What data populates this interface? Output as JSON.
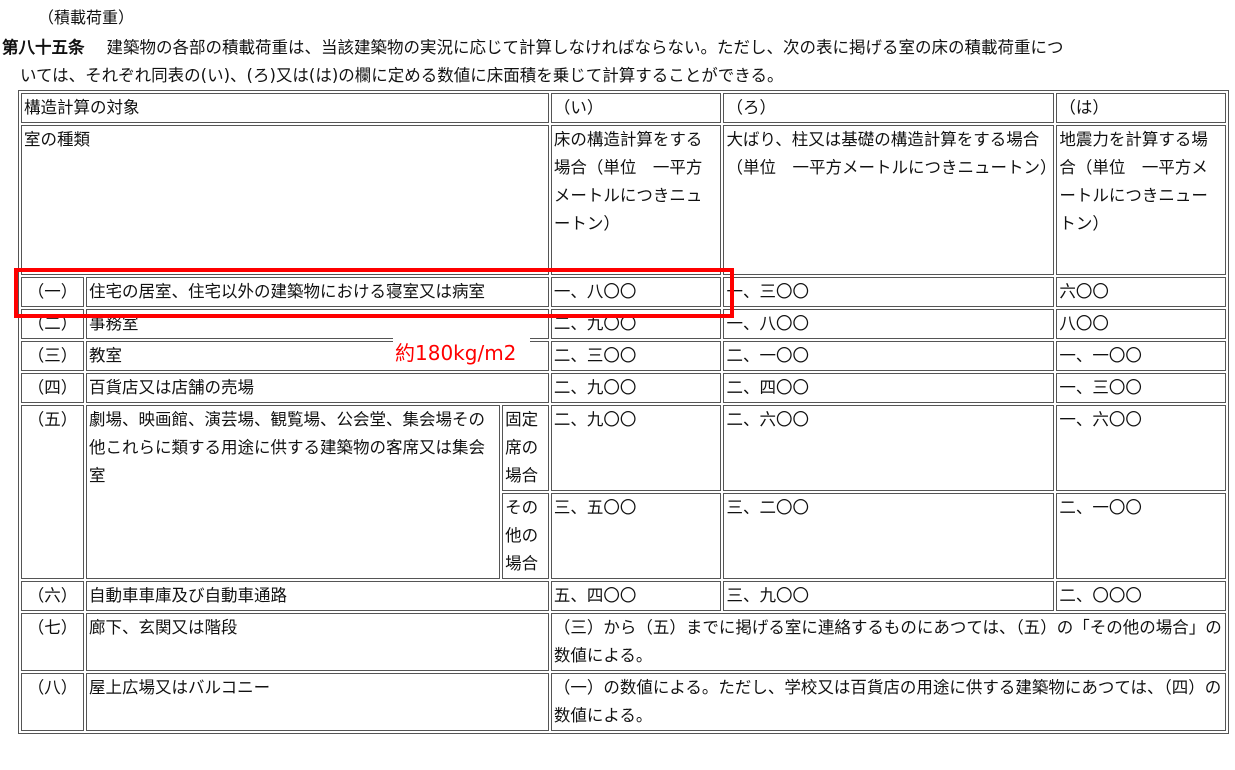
{
  "caption": "（積載荷重）",
  "article": {
    "number": "第八十五条",
    "text_line1": "建築物の各部の積載荷重は、当該建築物の実況に応じて計算しなければならない。ただし、次の表に掲げる室の床の積載荷重につ",
    "text_line2": "いては、それぞれ同表の(い)、(ろ)又は(は)の欄に定める数値に床面積を乗じて計算することができる。"
  },
  "table": {
    "header_target": "構造計算の対象",
    "col_i": "（い）",
    "col_ro": "（ろ）",
    "col_ha": "（は）",
    "room_type": "室の種類",
    "desc_i": "床の構造計算をする場合（単位　一平方メートルにつきニュートン）",
    "desc_ro": "大ばり、柱又は基礎の構造計算をする場合（単位　一平方メートルにつきニュートン）",
    "desc_ha": "地震力を計算する場合（単位　一平方メートルにつきニュートン）",
    "rows": [
      {
        "idx": "（一）",
        "name": "住宅の居室、住宅以外の建築物における寝室又は病室",
        "i": "一、八〇〇",
        "ro": "一、三〇〇",
        "ha": "六〇〇"
      },
      {
        "idx": "（二）",
        "name": "事務室",
        "i": "二、九〇〇",
        "ro": "一、八〇〇",
        "ha": "八〇〇"
      },
      {
        "idx": "（三）",
        "name": "教室",
        "i": "二、三〇〇",
        "ro": "二、一〇〇",
        "ha": "一、一〇〇"
      },
      {
        "idx": "（四）",
        "name": "百貨店又は店舗の売場",
        "i": "二、九〇〇",
        "ro": "二、四〇〇",
        "ha": "一、三〇〇"
      },
      {
        "idx": "（五）",
        "name": "劇場、映画館、演芸場、観覧場、公会堂、集会場その他これらに類する用途に供する建築物の客席又は集会室",
        "sub1": "固定席の場合",
        "sub1_i": "二、九〇〇",
        "sub1_ro": "二、六〇〇",
        "sub1_ha": "一、六〇〇",
        "sub2": "その他の場合",
        "sub2_i": "三、五〇〇",
        "sub2_ro": "三、二〇〇",
        "sub2_ha": "二、一〇〇"
      },
      {
        "idx": "（六）",
        "name": "自動車車庫及び自動車通路",
        "i": "五、四〇〇",
        "ro": "三、九〇〇",
        "ha": "二、〇〇〇"
      },
      {
        "idx": "（七）",
        "name": "廊下、玄関又は階段",
        "note": "（三）から（五）までに掲げる室に連絡するものにあつては、（五）の「その他の場合」の数値による。"
      },
      {
        "idx": "（八）",
        "name": "屋上広場又はバルコニー",
        "note": "（一）の数値による。ただし、学校又は百貨店の用途に供する建築物にあつては、（四）の数値による。"
      }
    ]
  },
  "annotation": {
    "text": "約180kg/m2",
    "color": "#ff0000"
  }
}
